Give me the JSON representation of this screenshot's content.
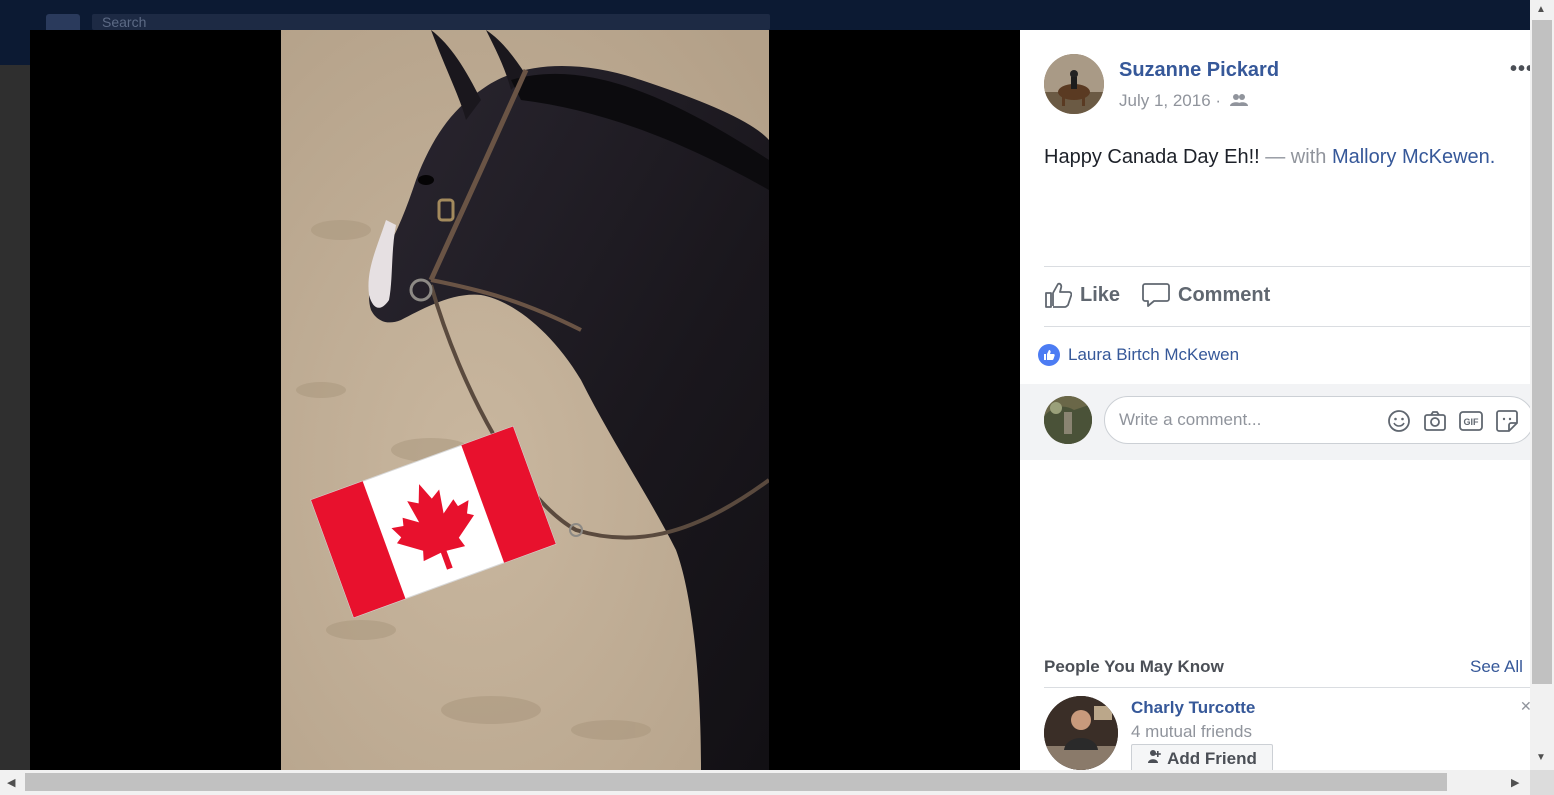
{
  "background": {
    "search_placeholder": "Search"
  },
  "post": {
    "author": "Suzanne Pickard",
    "date": "July 1, 2016 ·",
    "text": "Happy Canada Day Eh!!",
    "with_prefix": "— with",
    "tagged": "Mallory McKewen.",
    "more_label": "•••"
  },
  "actions": {
    "like": "Like",
    "comment": "Comment"
  },
  "reactions": {
    "reactor": "Laura Birtch McKewen"
  },
  "comment_input": {
    "placeholder": "Write a comment...",
    "icons": [
      "emoji-icon",
      "camera-icon",
      "gif-icon",
      "sticker-icon"
    ],
    "gif_label": "GIF"
  },
  "pymk": {
    "title": "People You May Know",
    "see_all": "See All",
    "person": {
      "name": "Charly Turcotte",
      "mutual": "4 mutual friends",
      "add_label": "Add Friend"
    }
  },
  "colors": {
    "link": "#365899",
    "theater_bg": "#000000",
    "like_badge": "#4c7cf3"
  }
}
